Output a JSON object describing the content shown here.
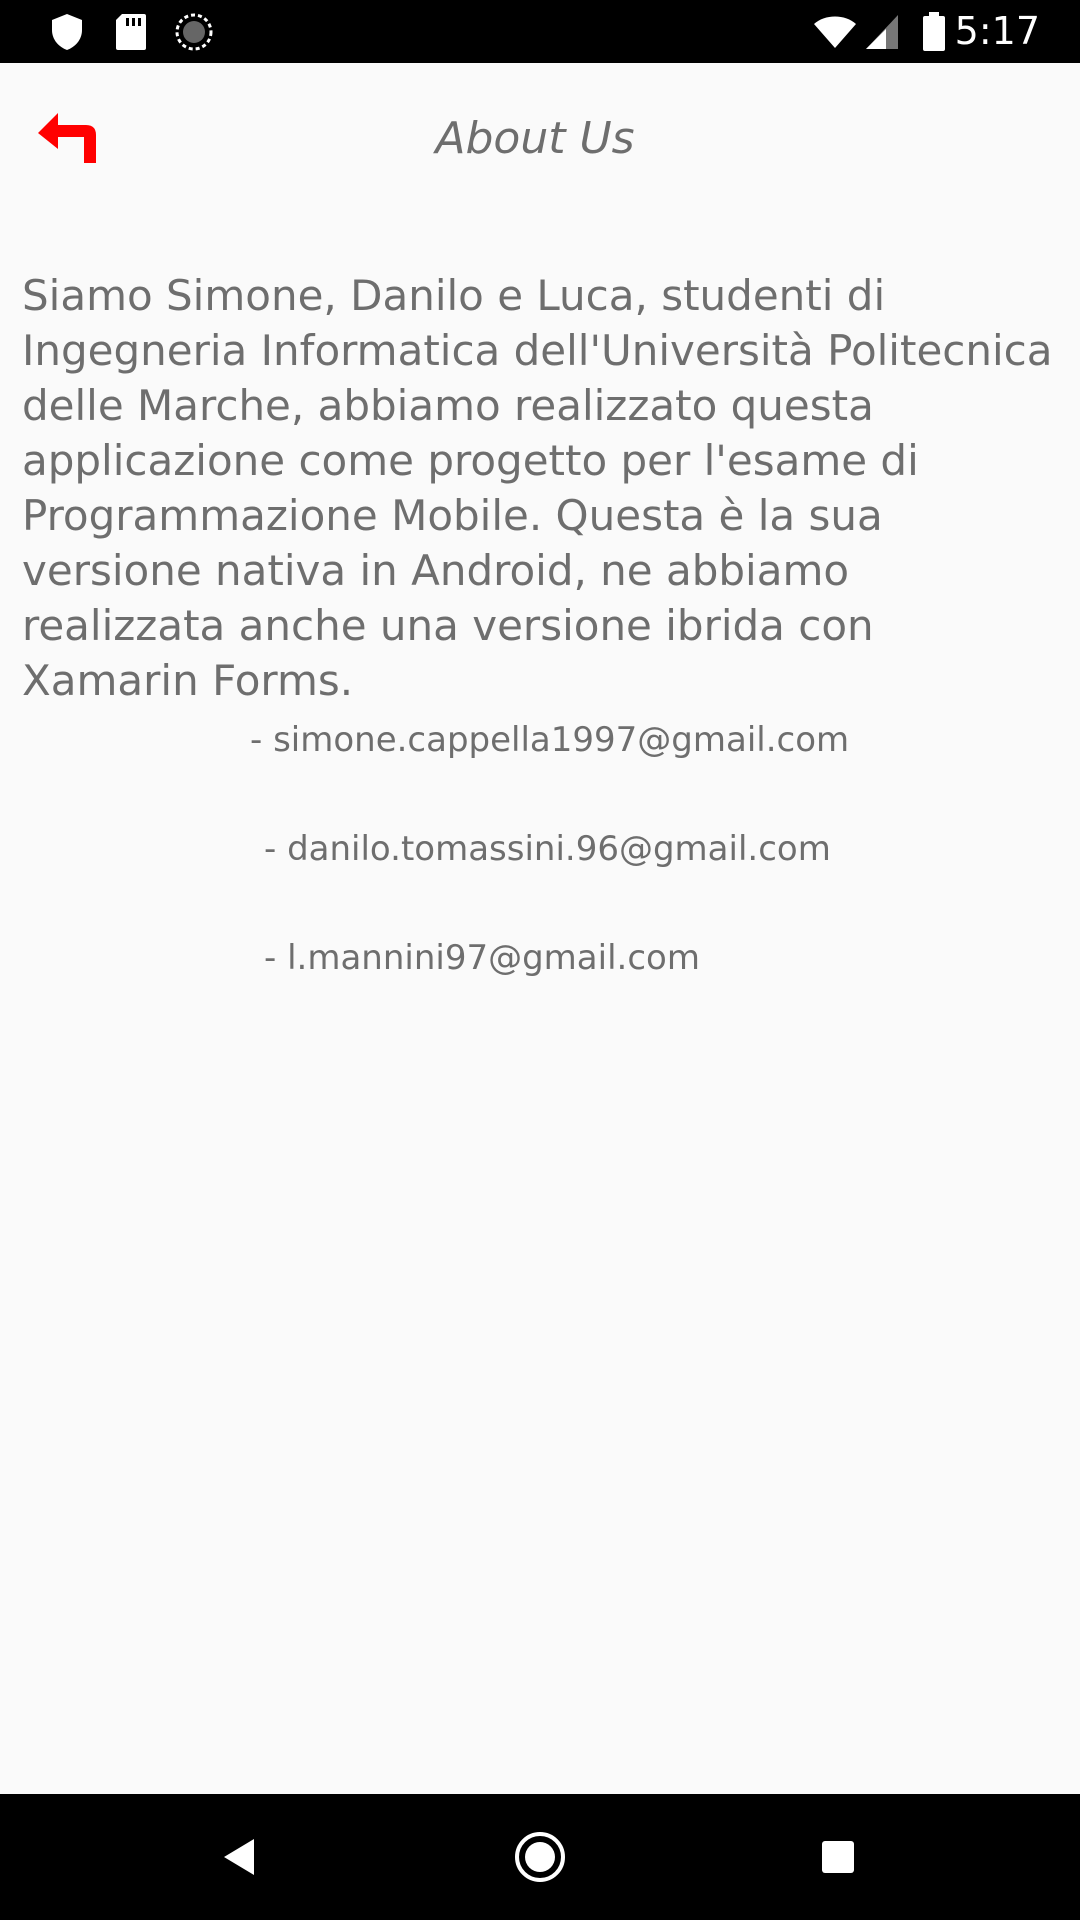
{
  "status_bar": {
    "time": "5:17",
    "left_icons": [
      "shield-icon",
      "sd-card-icon",
      "sync-icon"
    ],
    "right_icons": [
      "wifi-icon",
      "signal-icon",
      "battery-icon"
    ]
  },
  "header": {
    "title": "About Us",
    "back_icon": "back-arrow-icon",
    "accent_color": "#ff0000"
  },
  "content": {
    "description": "Siamo Simone, Danilo e Luca, studenti di Ingegneria Informatica dell'Università Politecnica delle Marche, abbiamo realizzato questa applicazione come progetto per l'esame di Programmazione Mobile. Questa è la sua versione nativa in Android, ne abbiamo realizzata anche una versione ibrida con Xamarin Forms.",
    "emails": [
      "- simone.cappella1997@gmail.com",
      "- danilo.tomassini.96@gmail.com",
      "- l.mannini97@gmail.com"
    ]
  },
  "nav_bar": {
    "icons": [
      "back-triangle-icon",
      "home-circle-icon",
      "recents-square-icon"
    ]
  }
}
